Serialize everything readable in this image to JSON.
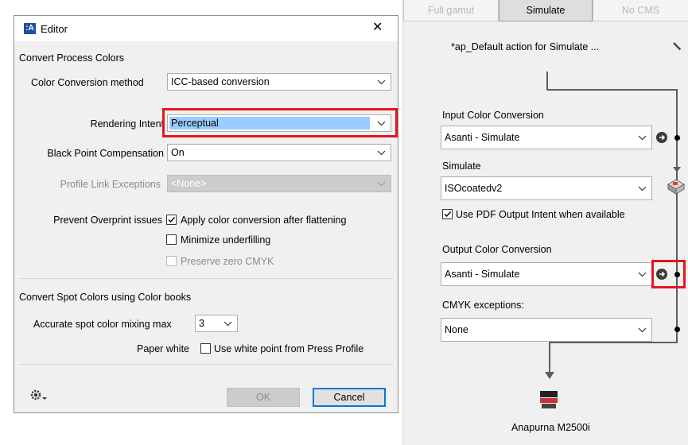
{
  "dialog": {
    "title": "Editor",
    "close_glyph": "✕",
    "sections": {
      "process_colors": "Convert Process Colors",
      "spot_colors": "Convert Spot Colors using Color books"
    },
    "fields": {
      "conversion_method": {
        "label": "Color Conversion method",
        "value": "ICC-based conversion"
      },
      "rendering_intent": {
        "label": "Rendering Intent",
        "value": "Perceptual"
      },
      "black_point": {
        "label": "Black Point Compensation",
        "value": "On"
      },
      "profile_link": {
        "label": "Profile Link Exceptions",
        "value": "<None>"
      },
      "prevent_overprint": {
        "label": "Prevent Overprint issues"
      },
      "apply_after_flattening": {
        "label": "Apply color conversion after flattening",
        "checked": true
      },
      "minimize_underfilling": {
        "label": "Minimize underfilling",
        "checked": false
      },
      "preserve_zero_cmyk": {
        "label": "Preserve zero CMYK",
        "checked": false
      },
      "spot_mixing_max": {
        "label": "Accurate spot color mixing max",
        "value": "3"
      },
      "paper_white": {
        "label": "Paper white",
        "checkbox_label": "Use white point from Press Profile",
        "checked": false
      }
    },
    "buttons": {
      "ok": "OK",
      "cancel": "Cancel"
    },
    "icons": {
      "app": "editor-app-icon",
      "settings": "gear-dropdown-icon"
    }
  },
  "panel": {
    "tabs": [
      {
        "label": "Full gamut",
        "active": false
      },
      {
        "label": "Simulate",
        "active": true
      },
      {
        "label": "No CMS",
        "active": false
      }
    ],
    "action_name": "*ap_Default action for Simulate ...",
    "input_conversion": {
      "label": "Input Color Conversion",
      "value": "Asanti - Simulate"
    },
    "simulate": {
      "label": "Simulate",
      "value": "ISOcoatedv2"
    },
    "use_output_intent": {
      "label": "Use PDF Output Intent when available",
      "checked": true
    },
    "output_conversion": {
      "label": "Output Color Conversion",
      "value": "Asanti - Simulate"
    },
    "cmyk_exceptions": {
      "label": "CMYK exceptions:",
      "value": "None"
    },
    "printer_name": "Anapurna M2500i"
  },
  "colors": {
    "highlight": "#e8141d",
    "selection": "#99ccff",
    "disabled_field": "#cccccc"
  }
}
